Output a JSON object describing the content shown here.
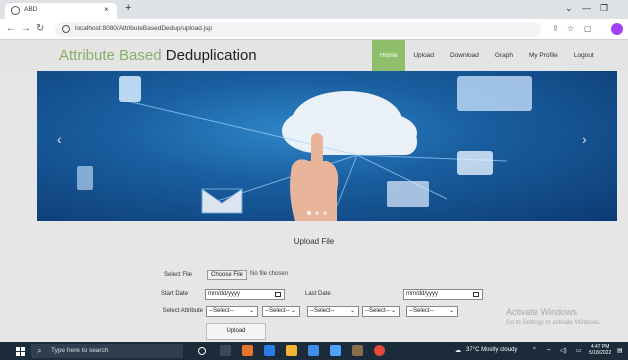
{
  "browser": {
    "tab_title": "ABD",
    "tab_close": "×",
    "new_tab": "+",
    "url": "localhost:8080/AttributeBasedDedup/upload.jsp",
    "controls": {
      "minimize": "—",
      "maximize": "❐",
      "collapse": "⌄"
    }
  },
  "site": {
    "title_accent": "Attribute Based",
    "title_rest": " Deduplication",
    "nav": [
      {
        "label": "Home",
        "active": true
      },
      {
        "label": "Upload",
        "active": false
      },
      {
        "label": "Download",
        "active": false
      },
      {
        "label": "Graph",
        "active": false
      },
      {
        "label": "My Profile",
        "active": false
      },
      {
        "label": "Logout",
        "active": false
      }
    ],
    "accent_color": "#8fbf6a"
  },
  "banner": {
    "prev": "‹",
    "next": "›"
  },
  "form": {
    "heading": "Upload File",
    "select_file_label": "Select File",
    "choose_file_button": "Choose File",
    "file_status": "No file chosen",
    "start_date_label": "Start Date",
    "start_date_placeholder": "mm/dd/yyyy",
    "last_date_label": "Last Date",
    "last_date_placeholder": "mm/dd/yyyy",
    "select_attribute_label": "Select Attribute",
    "select_options": [
      "--Select--",
      "--Select--",
      "--Select--",
      "--Select--",
      "--Select--"
    ],
    "upload_button": "Upload"
  },
  "watermark": {
    "title": "Activate Windows",
    "subtitle": "Go to Settings to activate Windows."
  },
  "taskbar": {
    "search_placeholder": "Type here to search",
    "weather": "37°C  Mostly cloudy",
    "time": "4:47 PM",
    "date": "5/18/2022"
  }
}
